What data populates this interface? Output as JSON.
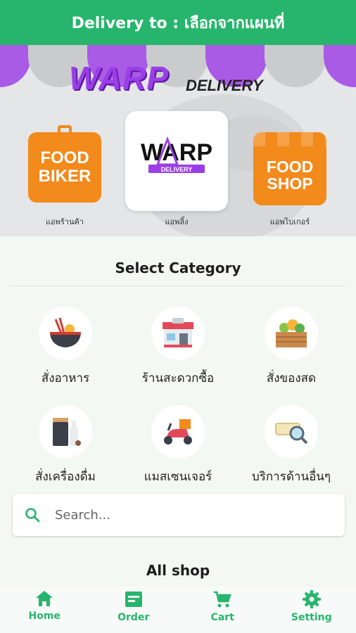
{
  "header": {
    "title": "Delivery to : เลือกจากแผนที่"
  },
  "banner": {
    "brand": "WARP",
    "brand_sub": "DELIVERY",
    "apps": [
      {
        "name": "FOOD BIKER",
        "line1": "FOOD",
        "line2": "BIKER",
        "label": "แอพร้านค้า"
      },
      {
        "name": "WARP DELIVERY",
        "logo_main": "WARP",
        "logo_sub": "DELIVERY",
        "label": "แอพลิ้ง"
      },
      {
        "name": "FOOD SHOP",
        "line1": "FOOD",
        "line2": "SHOP",
        "label": "แอพไบเกอร์"
      }
    ]
  },
  "category": {
    "title": "Select Category",
    "items": [
      {
        "label": "สั่งอาหาร",
        "icon": "food-bowl-icon"
      },
      {
        "label": "ร้านสะดวกซื้อ",
        "icon": "convenience-store-icon"
      },
      {
        "label": "สั่งของสด",
        "icon": "fresh-produce-icon"
      },
      {
        "label": "สั่งเครื่องดื่ม",
        "icon": "drinks-icon"
      },
      {
        "label": "แมสเซนเจอร์",
        "icon": "scooter-icon"
      },
      {
        "label": "บริการด้านอื่นๆ",
        "icon": "search-service-icon"
      }
    ]
  },
  "search": {
    "placeholder": "Search..."
  },
  "all_shop": {
    "title": "All shop"
  },
  "nav": {
    "items": [
      {
        "label": "Home",
        "icon": "home-icon"
      },
      {
        "label": "Order",
        "icon": "order-icon"
      },
      {
        "label": "Cart",
        "icon": "cart-icon"
      },
      {
        "label": "Setting",
        "icon": "gear-icon"
      }
    ]
  },
  "colors": {
    "primary_green": "#27b56d",
    "brand_purple": "#9b3ee8",
    "app_orange": "#f28a1c"
  }
}
